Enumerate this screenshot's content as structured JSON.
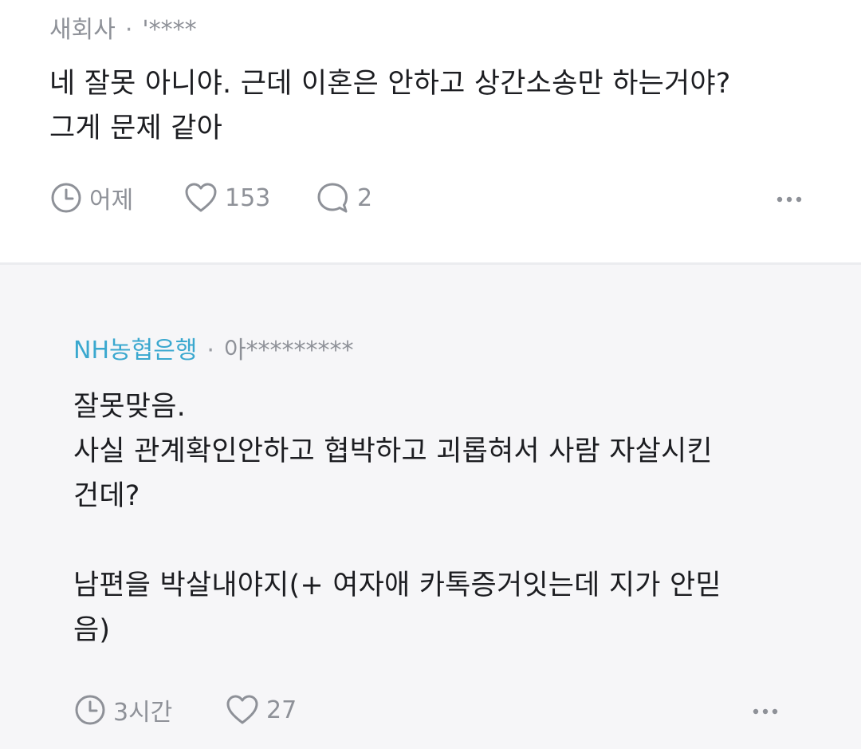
{
  "top_comment": {
    "company": "새회사",
    "separator": "·",
    "author": "'****",
    "text": "네 잘못 아니야. 근데 이혼은 안하고 상간소송만 하는거야?\n그게 문제 같아",
    "time": "어제",
    "likes": "153",
    "replies": "2",
    "icons": [
      "clock-icon",
      "heart-icon",
      "comment-icon",
      "more-icon"
    ]
  },
  "reply_comment": {
    "company": "NH농협은행",
    "separator": "·",
    "author": "아*********",
    "text": "잘못맞음.\n사실 관계확인안하고 협박하고 괴롭혀서 사람 자살시킨\n건데?\n\n남편을 박살내야지(+ 여자애 카톡증거잇는데 지가 안믿\n음)",
    "time": "3시간",
    "likes": "27",
    "icons": [
      "clock-icon",
      "heart-icon",
      "more-icon"
    ]
  },
  "colors": {
    "brand_company": "#3aa8cf",
    "meta_gray": "#8e9198",
    "body_text": "#1c1d21",
    "reply_background": "#f6f6f8",
    "separator": "#ebecef"
  }
}
